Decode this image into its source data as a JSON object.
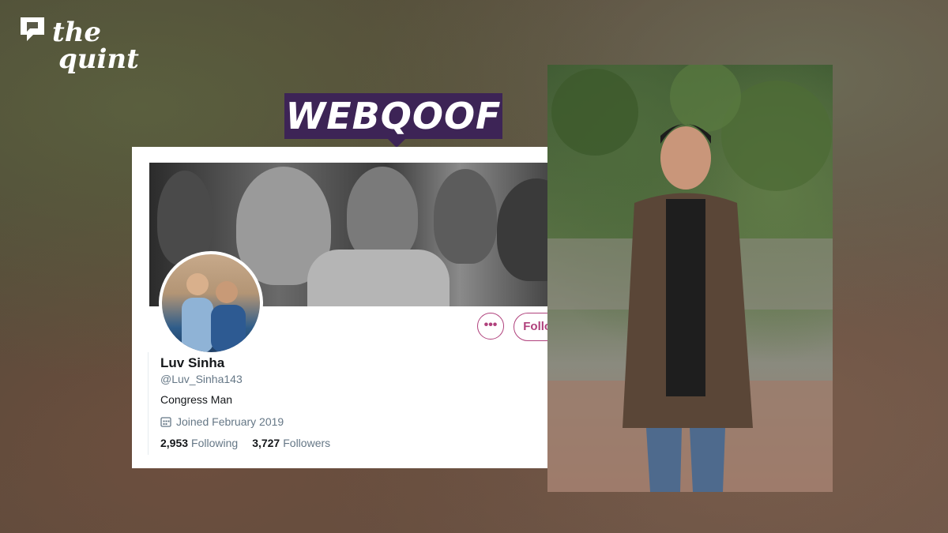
{
  "brand": {
    "line1": "the",
    "line2": "quint"
  },
  "badge": {
    "label": "WEBQOOF"
  },
  "profile": {
    "name": "Luv Sinha",
    "handle": "@Luv_Sinha143",
    "bio": "Congress Man",
    "joined": "Joined February 2019",
    "following_count": "2,953",
    "following_label": "Following",
    "followers_count": "3,727",
    "followers_label": "Followers",
    "more_label": "•••",
    "follow_label": "Follow"
  },
  "colors": {
    "badge_bg": "#3d2456",
    "button_accent": "#b0417c"
  }
}
